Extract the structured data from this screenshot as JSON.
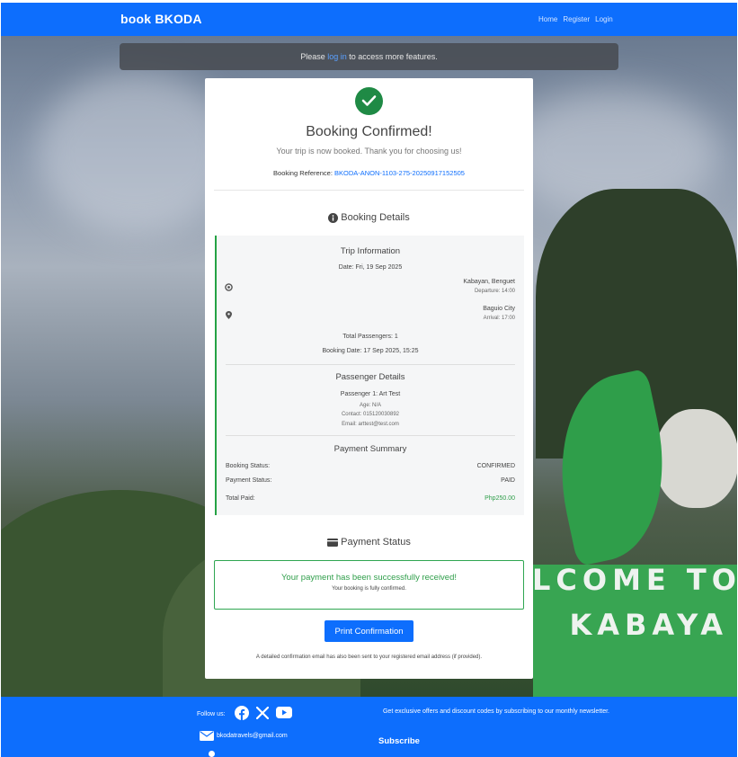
{
  "navbar": {
    "brand": "book BKODA",
    "links": [
      "Home",
      "Register",
      "Login"
    ]
  },
  "alert": {
    "before": "Please ",
    "link": "log in",
    "after": " to access more features."
  },
  "confirmation": {
    "title": "Booking Confirmed!",
    "subtitle": "Your trip is now booked. Thank you for choosing us!",
    "ref_label": "Booking Reference: ",
    "ref_value": "BKODA-ANON-1103-275-20250917152505"
  },
  "details": {
    "heading": "Booking Details",
    "trip_heading": "Trip Information",
    "date": "Date: Fri, 19 Sep 2025",
    "origin": "Kabayan, Benguet",
    "departure": "Departure: 14:00",
    "destination": "Baguio City",
    "arrival": "Arrival: 17:00",
    "total_passengers": "Total Passengers: 1",
    "booking_date": "Booking Date: 17 Sep 2025, 15:25",
    "passenger_heading": "Passenger Details",
    "passenger_name": "Passenger 1: Art Test",
    "age": "Age: N/A",
    "contact": "Contact: 015120030892",
    "email": "Email: arttest@test.com",
    "payment_heading": "Payment Summary",
    "booking_status_label": "Booking Status:",
    "booking_status_value": "CONFIRMED",
    "payment_status_label": "Payment Status:",
    "payment_status_value": "PAID",
    "total_paid_label": "Total Paid:",
    "total_paid_value": "Php250.00"
  },
  "payment_status": {
    "heading": "Payment Status",
    "message": "Your payment has been successfully received!",
    "submessage": "Your booking is fully confirmed.",
    "print_button": "Print Confirmation",
    "email_note": "A detailed confirmation email has also been sent to your registered email address (if provided)."
  },
  "background_sign": "LCOME TO\nKABAYA",
  "footer": {
    "follow_label": "Follow us:",
    "social_icons": [
      "facebook-icon",
      "x-icon",
      "youtube-icon"
    ],
    "email": "bkodatravels@gmail.com",
    "offer_text": "Get exclusive offers and discount codes by subscribing to our monthly newsletter.",
    "subscribe": "Subscribe"
  },
  "colors": {
    "primary": "#0d6efd",
    "success": "#1f8a45",
    "accent_green": "#25a244"
  }
}
